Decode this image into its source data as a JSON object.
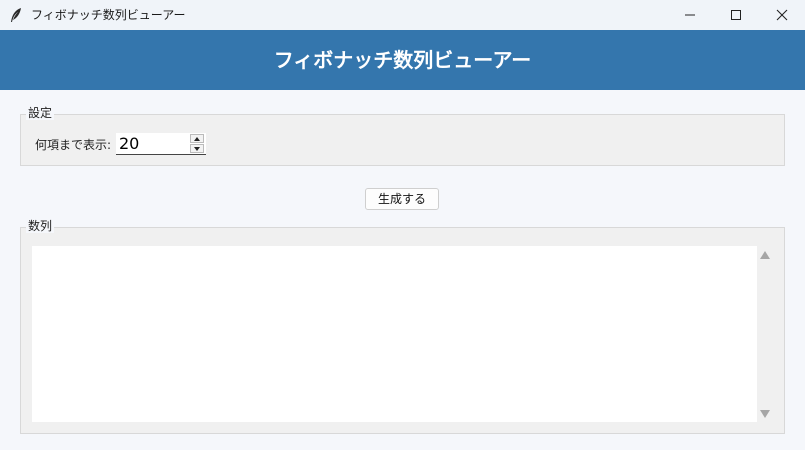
{
  "window": {
    "title": "フィボナッチ数列ビューアー",
    "app_icon": "feather-icon",
    "controls": [
      "minimize-icon",
      "maximize-icon",
      "close-icon"
    ]
  },
  "header": {
    "title": "フィボナッチ数列ビューアー",
    "background": "#3476ad"
  },
  "settings": {
    "group_label": "設定",
    "count_label": "何項まで表示:",
    "count_value": "20"
  },
  "actions": {
    "generate_label": "生成する"
  },
  "sequence": {
    "group_label": "数列",
    "text": ""
  }
}
